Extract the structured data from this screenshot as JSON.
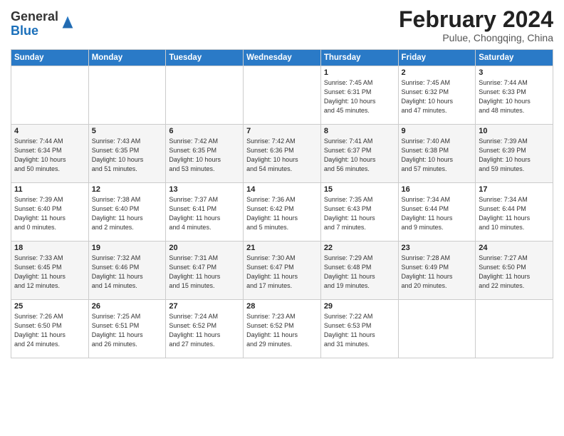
{
  "header": {
    "logo_general": "General",
    "logo_blue": "Blue",
    "title": "February 2024",
    "location": "Pulue, Chongqing, China"
  },
  "weekdays": [
    "Sunday",
    "Monday",
    "Tuesday",
    "Wednesday",
    "Thursday",
    "Friday",
    "Saturday"
  ],
  "weeks": [
    [
      {
        "day": "",
        "info": ""
      },
      {
        "day": "",
        "info": ""
      },
      {
        "day": "",
        "info": ""
      },
      {
        "day": "",
        "info": ""
      },
      {
        "day": "1",
        "info": "Sunrise: 7:45 AM\nSunset: 6:31 PM\nDaylight: 10 hours\nand 45 minutes."
      },
      {
        "day": "2",
        "info": "Sunrise: 7:45 AM\nSunset: 6:32 PM\nDaylight: 10 hours\nand 47 minutes."
      },
      {
        "day": "3",
        "info": "Sunrise: 7:44 AM\nSunset: 6:33 PM\nDaylight: 10 hours\nand 48 minutes."
      }
    ],
    [
      {
        "day": "4",
        "info": "Sunrise: 7:44 AM\nSunset: 6:34 PM\nDaylight: 10 hours\nand 50 minutes."
      },
      {
        "day": "5",
        "info": "Sunrise: 7:43 AM\nSunset: 6:35 PM\nDaylight: 10 hours\nand 51 minutes."
      },
      {
        "day": "6",
        "info": "Sunrise: 7:42 AM\nSunset: 6:35 PM\nDaylight: 10 hours\nand 53 minutes."
      },
      {
        "day": "7",
        "info": "Sunrise: 7:42 AM\nSunset: 6:36 PM\nDaylight: 10 hours\nand 54 minutes."
      },
      {
        "day": "8",
        "info": "Sunrise: 7:41 AM\nSunset: 6:37 PM\nDaylight: 10 hours\nand 56 minutes."
      },
      {
        "day": "9",
        "info": "Sunrise: 7:40 AM\nSunset: 6:38 PM\nDaylight: 10 hours\nand 57 minutes."
      },
      {
        "day": "10",
        "info": "Sunrise: 7:39 AM\nSunset: 6:39 PM\nDaylight: 10 hours\nand 59 minutes."
      }
    ],
    [
      {
        "day": "11",
        "info": "Sunrise: 7:39 AM\nSunset: 6:40 PM\nDaylight: 11 hours\nand 0 minutes."
      },
      {
        "day": "12",
        "info": "Sunrise: 7:38 AM\nSunset: 6:40 PM\nDaylight: 11 hours\nand 2 minutes."
      },
      {
        "day": "13",
        "info": "Sunrise: 7:37 AM\nSunset: 6:41 PM\nDaylight: 11 hours\nand 4 minutes."
      },
      {
        "day": "14",
        "info": "Sunrise: 7:36 AM\nSunset: 6:42 PM\nDaylight: 11 hours\nand 5 minutes."
      },
      {
        "day": "15",
        "info": "Sunrise: 7:35 AM\nSunset: 6:43 PM\nDaylight: 11 hours\nand 7 minutes."
      },
      {
        "day": "16",
        "info": "Sunrise: 7:34 AM\nSunset: 6:44 PM\nDaylight: 11 hours\nand 9 minutes."
      },
      {
        "day": "17",
        "info": "Sunrise: 7:34 AM\nSunset: 6:44 PM\nDaylight: 11 hours\nand 10 minutes."
      }
    ],
    [
      {
        "day": "18",
        "info": "Sunrise: 7:33 AM\nSunset: 6:45 PM\nDaylight: 11 hours\nand 12 minutes."
      },
      {
        "day": "19",
        "info": "Sunrise: 7:32 AM\nSunset: 6:46 PM\nDaylight: 11 hours\nand 14 minutes."
      },
      {
        "day": "20",
        "info": "Sunrise: 7:31 AM\nSunset: 6:47 PM\nDaylight: 11 hours\nand 15 minutes."
      },
      {
        "day": "21",
        "info": "Sunrise: 7:30 AM\nSunset: 6:47 PM\nDaylight: 11 hours\nand 17 minutes."
      },
      {
        "day": "22",
        "info": "Sunrise: 7:29 AM\nSunset: 6:48 PM\nDaylight: 11 hours\nand 19 minutes."
      },
      {
        "day": "23",
        "info": "Sunrise: 7:28 AM\nSunset: 6:49 PM\nDaylight: 11 hours\nand 20 minutes."
      },
      {
        "day": "24",
        "info": "Sunrise: 7:27 AM\nSunset: 6:50 PM\nDaylight: 11 hours\nand 22 minutes."
      }
    ],
    [
      {
        "day": "25",
        "info": "Sunrise: 7:26 AM\nSunset: 6:50 PM\nDaylight: 11 hours\nand 24 minutes."
      },
      {
        "day": "26",
        "info": "Sunrise: 7:25 AM\nSunset: 6:51 PM\nDaylight: 11 hours\nand 26 minutes."
      },
      {
        "day": "27",
        "info": "Sunrise: 7:24 AM\nSunset: 6:52 PM\nDaylight: 11 hours\nand 27 minutes."
      },
      {
        "day": "28",
        "info": "Sunrise: 7:23 AM\nSunset: 6:52 PM\nDaylight: 11 hours\nand 29 minutes."
      },
      {
        "day": "29",
        "info": "Sunrise: 7:22 AM\nSunset: 6:53 PM\nDaylight: 11 hours\nand 31 minutes."
      },
      {
        "day": "",
        "info": ""
      },
      {
        "day": "",
        "info": ""
      }
    ]
  ]
}
